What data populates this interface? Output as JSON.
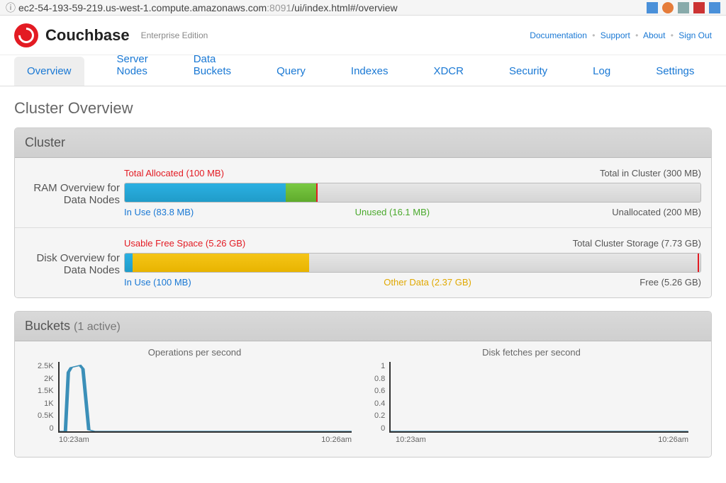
{
  "url": {
    "host": "ec2-54-193-59-219.us-west-1.compute.amazonaws.com",
    "port": ":8091",
    "path": "/ui/index.html#/overview"
  },
  "brand": {
    "name": "Couchbase",
    "edition": "Enterprise Edition"
  },
  "header_links": {
    "docs": "Documentation",
    "support": "Support",
    "about": "About",
    "signout": "Sign Out"
  },
  "nav": [
    "Overview",
    "Server Nodes",
    "Data Buckets",
    "Query",
    "Indexes",
    "XDCR",
    "Security",
    "Log",
    "Settings"
  ],
  "page_title": "Cluster Overview",
  "cluster": {
    "title": "Cluster",
    "ram": {
      "label": "RAM Overview for Data Nodes",
      "total_allocated": "Total Allocated (100 MB)",
      "total_cluster": "Total in Cluster (300 MB)",
      "in_use": "In Use (83.8 MB)",
      "unused": "Unused (16.1 MB)",
      "unallocated": "Unallocated (200 MB)"
    },
    "disk": {
      "label": "Disk Overview for Data Nodes",
      "usable_free": "Usable Free Space (5.26 GB)",
      "total_storage": "Total Cluster Storage (7.73 GB)",
      "in_use": "In Use (100 MB)",
      "other": "Other Data (2.37 GB)",
      "free": "Free (5.26 GB)"
    }
  },
  "buckets": {
    "title": "Buckets",
    "subtitle": "(1 active)",
    "chart1": {
      "title": "Operations per second",
      "yticks": [
        "2.5K",
        "2K",
        "1.5K",
        "1K",
        "0.5K",
        "0"
      ],
      "x_start": "10:23am",
      "x_end": "10:26am"
    },
    "chart2": {
      "title": "Disk fetches per second",
      "yticks": [
        "1",
        "0.8",
        "0.6",
        "0.4",
        "0.2",
        "0"
      ],
      "x_start": "10:23am",
      "x_end": "10:26am"
    }
  },
  "chart_data": [
    {
      "type": "line",
      "title": "Operations per second",
      "ylim": [
        0,
        2500
      ],
      "x_start": "10:23am",
      "x_end": "10:26am",
      "series": [
        {
          "name": "ops",
          "points_rel": [
            [
              0,
              1
            ],
            [
              0.02,
              1
            ],
            [
              0.03,
              0.15
            ],
            [
              0.04,
              0.08
            ],
            [
              0.07,
              0.05
            ],
            [
              0.08,
              0.1
            ],
            [
              0.1,
              0.98
            ],
            [
              0.12,
              1
            ],
            [
              1,
              1
            ]
          ]
        }
      ]
    },
    {
      "type": "line",
      "title": "Disk fetches per second",
      "ylim": [
        0,
        1
      ],
      "x_start": "10:23am",
      "x_end": "10:26am",
      "series": [
        {
          "name": "fetches",
          "points_rel": [
            [
              0,
              1
            ],
            [
              1,
              1
            ]
          ]
        }
      ]
    }
  ]
}
